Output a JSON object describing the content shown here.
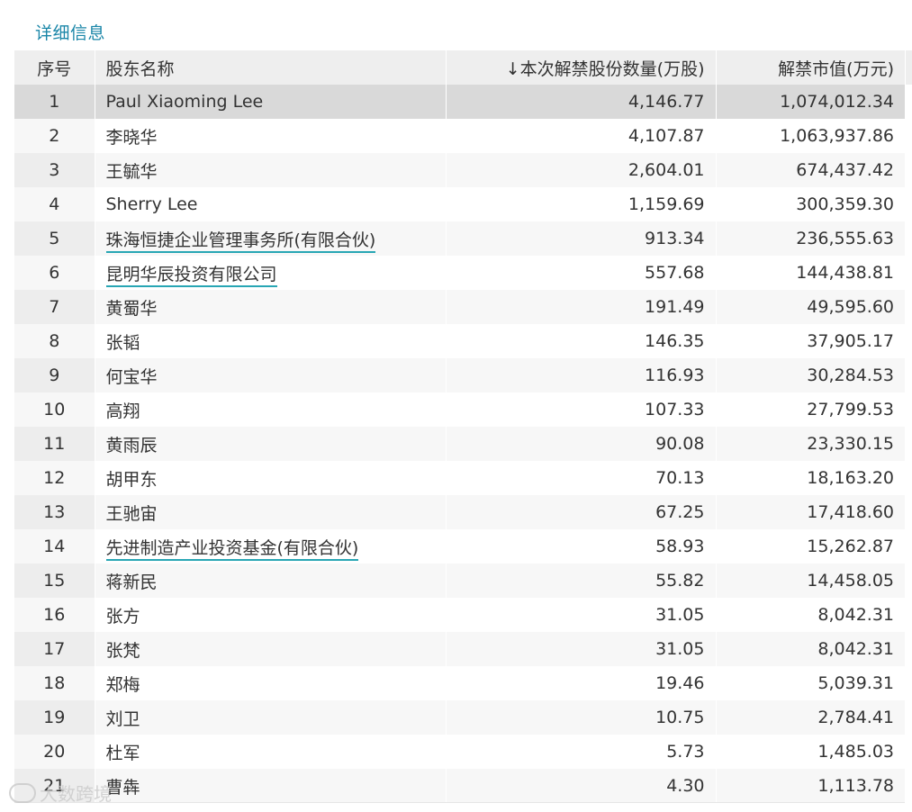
{
  "section_title": "详细信息",
  "table": {
    "headers": {
      "seq": "序号",
      "name": "股东名称",
      "shares": "↓本次解禁股份数量(万股)",
      "value": "解禁市值(万元)"
    },
    "rows": [
      {
        "seq": "1",
        "name": "Paul Xiaoming Lee",
        "shares": "4,146.77",
        "value": "1,074,012.34",
        "link": false,
        "selected": true
      },
      {
        "seq": "2",
        "name": "李晓华",
        "shares": "4,107.87",
        "value": "1,063,937.86",
        "link": false
      },
      {
        "seq": "3",
        "name": "王毓华",
        "shares": "2,604.01",
        "value": "674,437.42",
        "link": false
      },
      {
        "seq": "4",
        "name": "Sherry Lee",
        "shares": "1,159.69",
        "value": "300,359.30",
        "link": false
      },
      {
        "seq": "5",
        "name": "珠海恒捷企业管理事务所(有限合伙)",
        "shares": "913.34",
        "value": "236,555.63",
        "link": true
      },
      {
        "seq": "6",
        "name": "昆明华辰投资有限公司",
        "shares": "557.68",
        "value": "144,438.81",
        "link": true
      },
      {
        "seq": "7",
        "name": "黄蜀华",
        "shares": "191.49",
        "value": "49,595.60",
        "link": false
      },
      {
        "seq": "8",
        "name": "张韬",
        "shares": "146.35",
        "value": "37,905.17",
        "link": false
      },
      {
        "seq": "9",
        "name": "何宝华",
        "shares": "116.93",
        "value": "30,284.53",
        "link": false
      },
      {
        "seq": "10",
        "name": "高翔",
        "shares": "107.33",
        "value": "27,799.53",
        "link": false
      },
      {
        "seq": "11",
        "name": "黄雨辰",
        "shares": "90.08",
        "value": "23,330.15",
        "link": false
      },
      {
        "seq": "12",
        "name": "胡甲东",
        "shares": "70.13",
        "value": "18,163.20",
        "link": false
      },
      {
        "seq": "13",
        "name": "王驰宙",
        "shares": "67.25",
        "value": "17,418.60",
        "link": false
      },
      {
        "seq": "14",
        "name": "先进制造产业投资基金(有限合伙)",
        "shares": "58.93",
        "value": "15,262.87",
        "link": true
      },
      {
        "seq": "15",
        "name": "蒋新民",
        "shares": "55.82",
        "value": "14,458.05",
        "link": false
      },
      {
        "seq": "16",
        "name": "张方",
        "shares": "31.05",
        "value": "8,042.31",
        "link": false
      },
      {
        "seq": "17",
        "name": "张梵",
        "shares": "31.05",
        "value": "8,042.31",
        "link": false
      },
      {
        "seq": "18",
        "name": "郑梅",
        "shares": "19.46",
        "value": "5,039.31",
        "link": false
      },
      {
        "seq": "19",
        "name": "刘卫",
        "shares": "10.75",
        "value": "2,784.41",
        "link": false
      },
      {
        "seq": "20",
        "name": "杜军",
        "shares": "5.73",
        "value": "1,485.03",
        "link": false
      },
      {
        "seq": "21",
        "name": "曹犇",
        "shares": "4.30",
        "value": "1,113.78",
        "link": false
      }
    ]
  },
  "watermark": "大数跨境",
  "colors": {
    "title": "#1a86a8",
    "link_underline": "#28a6b4",
    "header_bg": "#eeeeee",
    "selected_row": "#d9d9d9"
  }
}
